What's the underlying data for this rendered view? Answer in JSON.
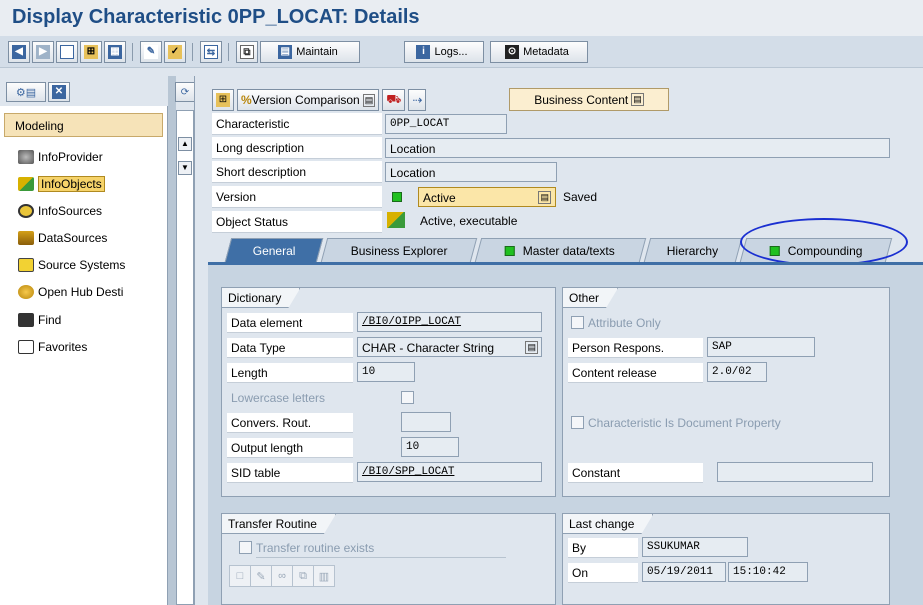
{
  "title": "Display Characteristic 0PP_LOCAT: Details",
  "toolbar": {
    "maintain_label": "Maintain",
    "logs_label": "Logs...",
    "metadata_label": "Metadata"
  },
  "nav": {
    "header": "Modeling",
    "items": [
      {
        "label": "InfoProvider",
        "icon": "infoprovider-icon"
      },
      {
        "label": "InfoObjects",
        "icon": "infoobjects-icon"
      },
      {
        "label": "InfoSources",
        "icon": "infosources-icon"
      },
      {
        "label": "DataSources",
        "icon": "datasources-icon"
      },
      {
        "label": "Source Systems",
        "icon": "source-systems-icon"
      },
      {
        "label": "Open Hub Desti",
        "icon": "open-hub-icon"
      },
      {
        "label": "Find",
        "icon": "binoculars-icon"
      },
      {
        "label": "Favorites",
        "icon": "favorites-icon"
      }
    ]
  },
  "inner_toolbar": {
    "version_comparison": "Version Comparison",
    "business_content": "Business Content"
  },
  "header_fields": {
    "characteristic_label": "Characteristic",
    "characteristic_value": "0PP_LOCAT",
    "long_desc_label": "Long description",
    "long_desc_value": "Location",
    "short_desc_label": "Short description",
    "short_desc_value": "Location",
    "version_label": "Version",
    "version_value": "Active",
    "version_status": "Saved",
    "object_status_label": "Object Status",
    "object_status_value": "Active, executable"
  },
  "tabs": [
    "General",
    "Business Explorer",
    "Master data/texts",
    "Hierarchy",
    "Compounding"
  ],
  "dictionary": {
    "title": "Dictionary",
    "data_element_label": "Data element",
    "data_element_value": "/BI0/OIPP_LOCAT",
    "data_type_label": "Data Type",
    "data_type_value": "CHAR - Character String",
    "length_label": "Length",
    "length_value": "10",
    "lowercase_label": "Lowercase letters",
    "convers_label": "Convers. Rout.",
    "output_length_label": "Output length",
    "output_length_value": "10",
    "sid_label": "SID table",
    "sid_value": "/BI0/SPP_LOCAT"
  },
  "other": {
    "title": "Other",
    "attribute_only_label": "Attribute Only",
    "person_label": "Person Respons.",
    "person_value": "SAP",
    "content_release_label": "Content release",
    "content_release_value": "2.0/02",
    "doc_property_label": "Characteristic Is Document Property",
    "constant_label": "Constant",
    "constant_value": ""
  },
  "transfer": {
    "title": "Transfer Routine",
    "exists_label": "Transfer routine exists"
  },
  "last_change": {
    "title": "Last change",
    "by_label": "By",
    "by_value": "SSUKUMAR",
    "on_label": "On",
    "date_value": "05/19/2011",
    "time_value": "15:10:42"
  },
  "colors": {
    "title": "#1f4e86",
    "active_tab": "#3f6fa6",
    "annotation_circle": "#1a2fd1",
    "status_green": "#20c020"
  }
}
